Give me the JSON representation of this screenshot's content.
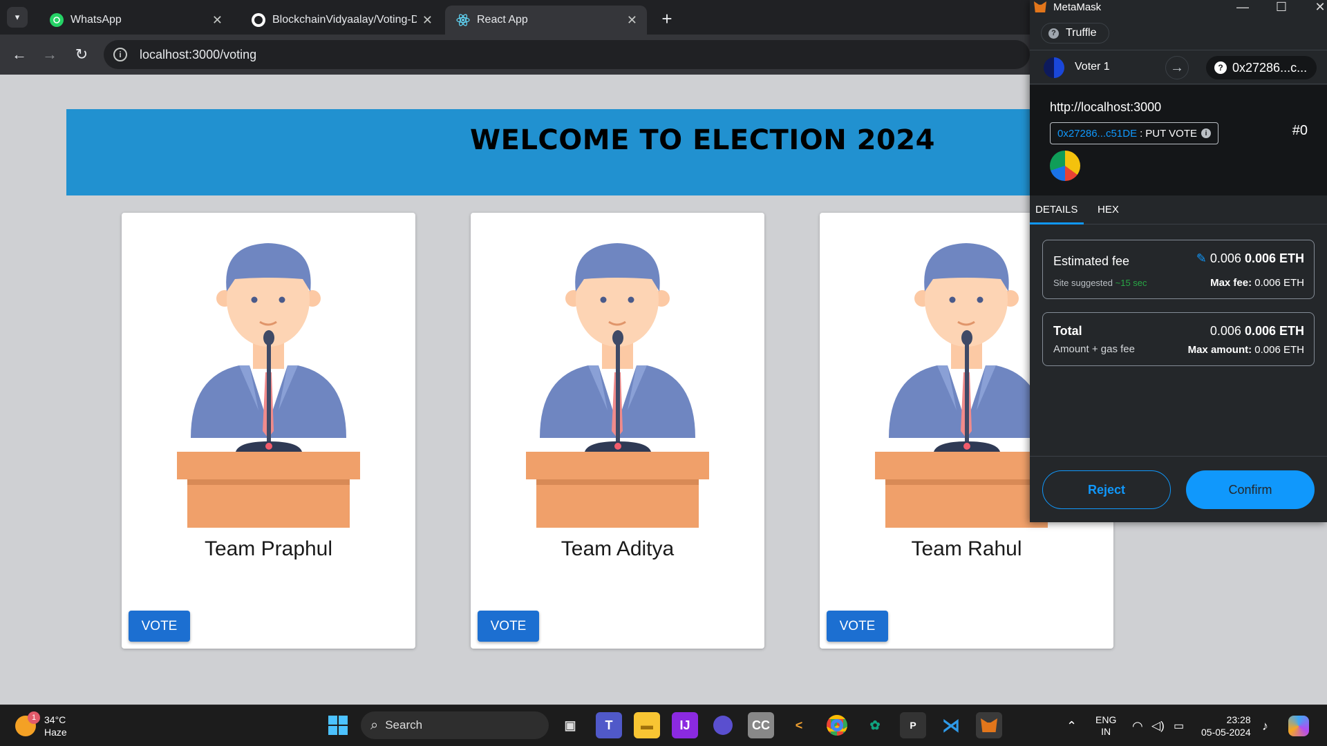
{
  "browser": {
    "tabs": [
      {
        "title": "WhatsApp",
        "active": false
      },
      {
        "title": "BlockchainVidyaalay/Voting-Da",
        "active": false
      },
      {
        "title": "React App",
        "active": true
      }
    ],
    "url": "localhost:3000/voting"
  },
  "page": {
    "heading": "WELCOME TO ELECTION 2024",
    "candidates": [
      {
        "name": "Team Praphul",
        "button": "VOTE"
      },
      {
        "name": "Team Aditya",
        "button": "VOTE"
      },
      {
        "name": "Team Rahul",
        "button": "VOTE"
      }
    ]
  },
  "metamask": {
    "app_title": "MetaMask",
    "network": "Truffle",
    "account": "Voter 1",
    "recipient": "0x27286...c...",
    "origin": "http://localhost:3000",
    "contract_address": "0x27286...c51DE",
    "method": "PUT VOTE",
    "nonce": "#0",
    "tabs": [
      "DETAILS",
      "HEX"
    ],
    "estimated_fee": {
      "label": "Estimated fee",
      "value_secondary": "0.006",
      "value_primary": "0.006 ETH",
      "site_suggested": "Site suggested",
      "timing": "~15 sec",
      "max_fee_label": "Max fee:",
      "max_fee": "0.006 ETH"
    },
    "total": {
      "label": "Total",
      "sub": "Amount + gas fee",
      "value_secondary": "0.006",
      "value_primary": "0.006 ETH",
      "max_amount_label": "Max amount:",
      "max_amount": "0.006 ETH"
    },
    "reject": "Reject",
    "confirm": "Confirm",
    "colors": {
      "accent": "#1098fc",
      "background": "#24272a"
    }
  },
  "taskbar": {
    "weather_temp": "34°C",
    "weather_desc": "Haze",
    "weather_badge": "1",
    "search": "Search",
    "lang_1": "ENG",
    "lang_2": "IN",
    "time": "23:28",
    "date": "05-05-2024"
  }
}
